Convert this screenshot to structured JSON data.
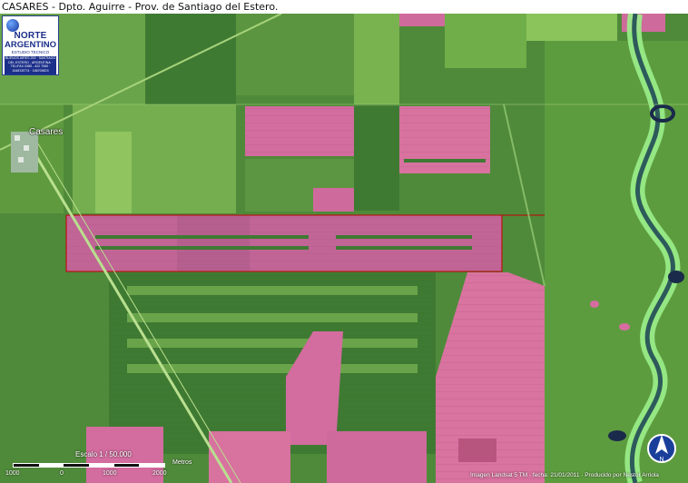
{
  "header": {
    "title": "CASARES - Dpto. Aguirre - Prov. de Santiago del Estero."
  },
  "logo": {
    "line1": "NORTE",
    "line2": "ARGENTINO",
    "line3": "ESTUDIO TECNICO",
    "info": "BUENOS AIRES 253 · SANTIAGO DEL ESTERO - ARGENTINA · TEL/FAX 0385 - 422 7080 · 15487/8774 · 156709874"
  },
  "map": {
    "town_label": "Casares"
  },
  "scale": {
    "title": "Escalo 1 / 50.000",
    "ticks": [
      "1000",
      "0",
      "1000",
      "2000"
    ],
    "unit": "Metros"
  },
  "credit": "Imagen Landsat 5 TM · fecha: 21/01/2011 · Producido por Nestor Arriola",
  "colors": {
    "vegetation": "#5f9a3f",
    "crop_pink": "#d86ca0",
    "highlight_box": "#c00000",
    "river": "#9af08a"
  },
  "north_arrow": {
    "icon": "north-arrow-icon",
    "letter": "N"
  }
}
